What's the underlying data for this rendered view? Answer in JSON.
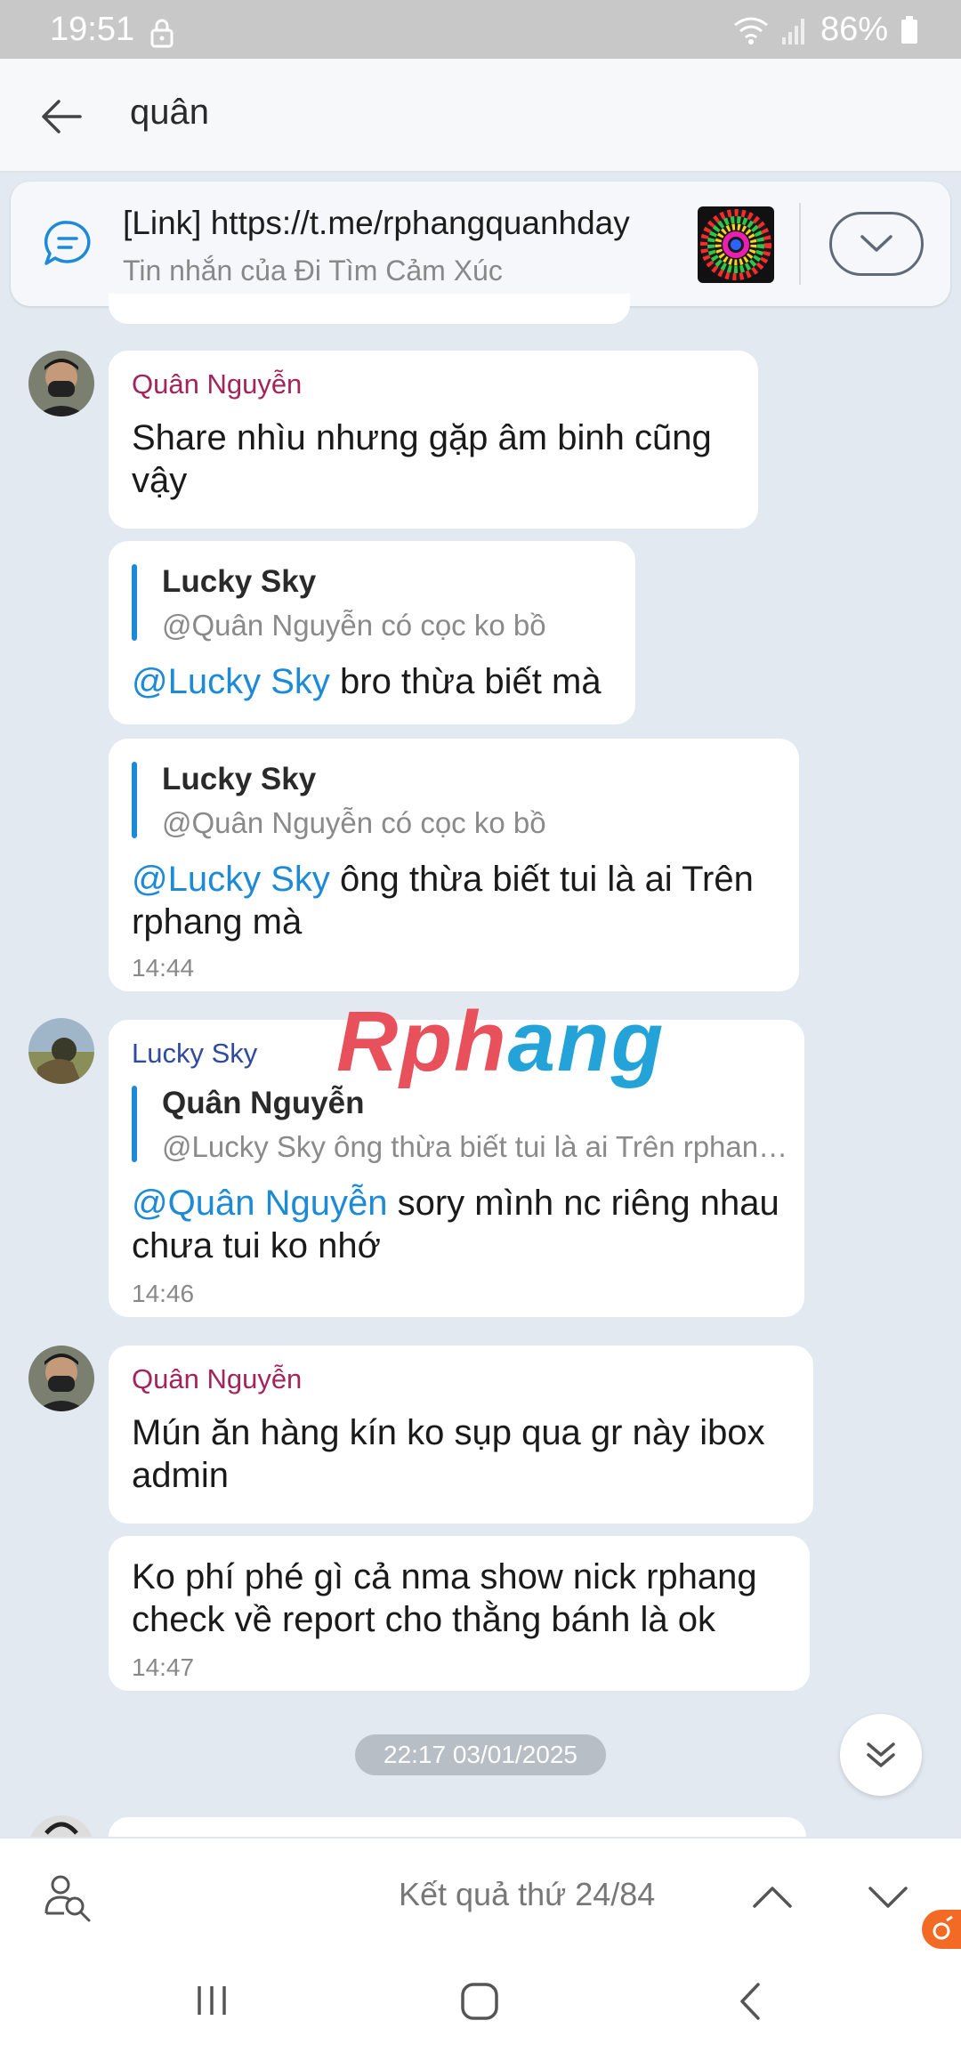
{
  "status_bar": {
    "time": "19:51",
    "battery": "86%"
  },
  "search": {
    "query": "quân"
  },
  "pinned": {
    "link": "[Link] https://t.me/rphangquanhday",
    "subtitle": "Tin nhắn của Đi Tìm Cảm Xúc"
  },
  "messages": [
    {
      "sender": "Quân Nguyễn",
      "text": "Share nhìu nhưng gặp âm binh cũng vậy"
    },
    {
      "quote_name": "Lucky Sky",
      "quote_text": "@Quân Nguyễn có cọc ko bồ",
      "mention": "@Lucky Sky",
      "text": " bro thừa biết mà"
    },
    {
      "quote_name": "Lucky Sky",
      "quote_text": "@Quân Nguyễn có cọc ko bồ",
      "mention": "@Lucky Sky",
      "text": " ông thừa biết tui là ai Trên rphang mà",
      "time": "14:44"
    },
    {
      "sender": "Lucky Sky",
      "quote_name": "Quân Nguyễn",
      "quote_text": "@Lucky Sky ông thừa biết tui là ai Trên rphan…",
      "mention": "@Quân Nguyễn",
      "text": " sory mình nc riêng nhau chưa tui ko nhớ",
      "time": "14:46"
    },
    {
      "sender": "Quân Nguyễn",
      "text": "Mún ăn hàng kín ko sụp qua gr này ibox admin"
    },
    {
      "text": "Ko phí phé gì cả nma show nick rphang check về report cho thằng bánh là ok",
      "time": "14:47"
    }
  ],
  "watermark": {
    "part1": "Rph",
    "part2": "ang"
  },
  "date_divider": "22:17 03/01/2025",
  "result_bar": {
    "text": "Kết quả thứ 24/84"
  },
  "colors": {
    "accent": "#1c8ad6",
    "sender_quan": "#a3245a",
    "sender_lucky": "#2f4aa0",
    "background": "#e2e9f1"
  }
}
